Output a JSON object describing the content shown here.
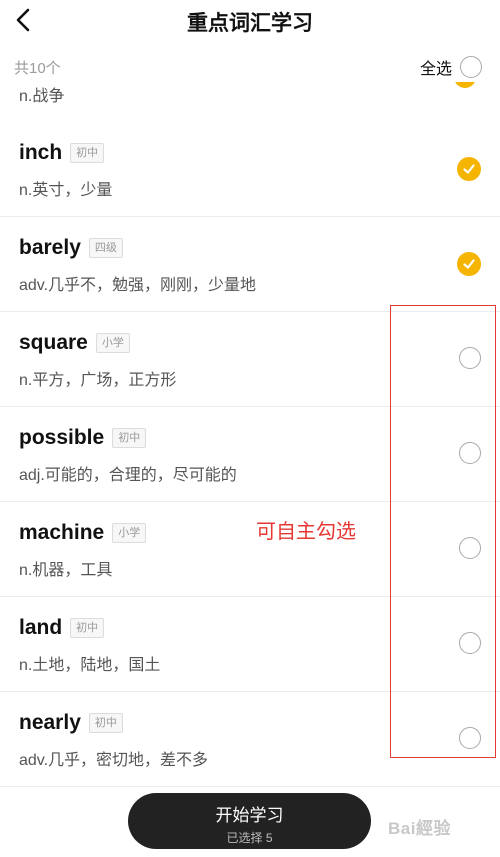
{
  "header": {
    "title": "重点词汇学习"
  },
  "toolbar": {
    "total_label": "共10个",
    "select_all_label": "全选"
  },
  "partial_item": {
    "meaning": "n.战争",
    "checked": true
  },
  "words": [
    {
      "word": "inch",
      "level": "初中",
      "meaning": "n.英寸，少量",
      "checked": true
    },
    {
      "word": "barely",
      "level": "四级",
      "meaning": "adv.几乎不，勉强，刚刚，少量地",
      "checked": true
    },
    {
      "word": "square",
      "level": "小学",
      "meaning": "n.平方，广场，正方形",
      "checked": false
    },
    {
      "word": "possible",
      "level": "初中",
      "meaning": "adj.可能的，合理的，尽可能的",
      "checked": false
    },
    {
      "word": "machine",
      "level": "小学",
      "meaning": "n.机器，工具",
      "checked": false
    },
    {
      "word": "land",
      "level": "初中",
      "meaning": "n.土地，陆地，国土",
      "checked": false
    },
    {
      "word": "nearly",
      "level": "初中",
      "meaning": "adv.几乎，密切地，差不多",
      "checked": false
    }
  ],
  "annotation": {
    "text": "可自主勾选",
    "color": "#e53935"
  },
  "footer": {
    "start_label": "开始学习",
    "selected_label": "已选择 5"
  },
  "watermark": {
    "text": "Bai經验"
  },
  "colors": {
    "accent": "#f5b400",
    "button_bg": "#222222"
  }
}
